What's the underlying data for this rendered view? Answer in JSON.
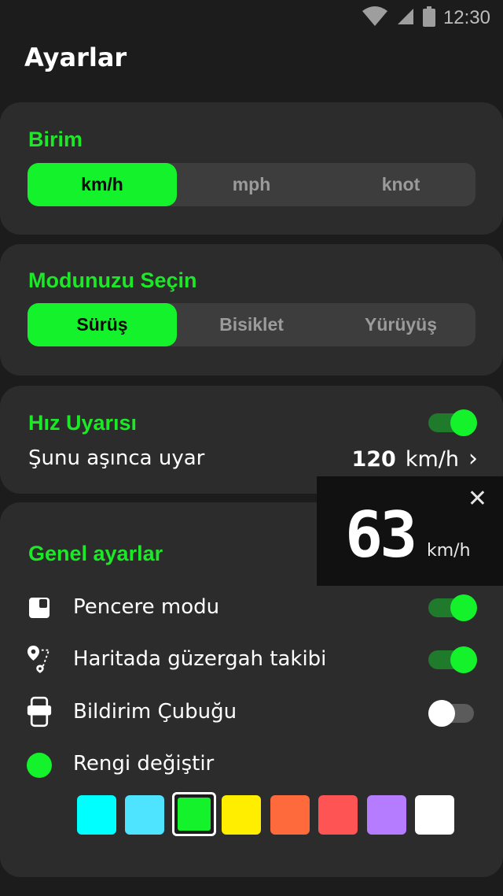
{
  "status_bar": {
    "time": "12:30",
    "icons": [
      "wifi-icon",
      "signal-icon",
      "battery-icon"
    ]
  },
  "page_title": "Ayarlar",
  "unit_section": {
    "title": "Birim",
    "options": [
      "km/h",
      "mph",
      "knot"
    ],
    "selected": "km/h"
  },
  "mode_section": {
    "title": "Modunuzu Seçin",
    "options": [
      "Sürüş",
      "Bisiklet",
      "Yürüyüş"
    ],
    "selected": "Sürüş"
  },
  "speed_alert": {
    "title": "Hız Uyarısı",
    "enabled": true,
    "label": "Şunu aşınca uyar",
    "value": "120",
    "unit": "km/h",
    "chevron": "›"
  },
  "general": {
    "title": "Genel ayarlar",
    "window_mode": {
      "label": "Pencere modu",
      "enabled": true,
      "icon": "window-icon"
    },
    "route_tracking": {
      "label": "Haritada güzergah takibi",
      "enabled": true,
      "icon": "route-pin-icon"
    },
    "notification_bar": {
      "label": "Bildirim Çubuğu",
      "enabled": false,
      "icon": "phone-notification-icon"
    },
    "color_change": {
      "label": "Rengi değiştir",
      "current_color": "#13f22a",
      "icon": "color-dot-icon"
    },
    "colors": [
      "#00ffff",
      "#4ee3ff",
      "#13f22a",
      "#ffee00",
      "#ff6a3d",
      "#ff5454",
      "#b57cff",
      "#ffffff"
    ],
    "selected_color_index": 2
  },
  "floating_speedometer": {
    "speed": "63",
    "unit": "km/h",
    "close": "✕"
  },
  "accent_color": "#13f22a",
  "background_color": "#1c1c1c"
}
